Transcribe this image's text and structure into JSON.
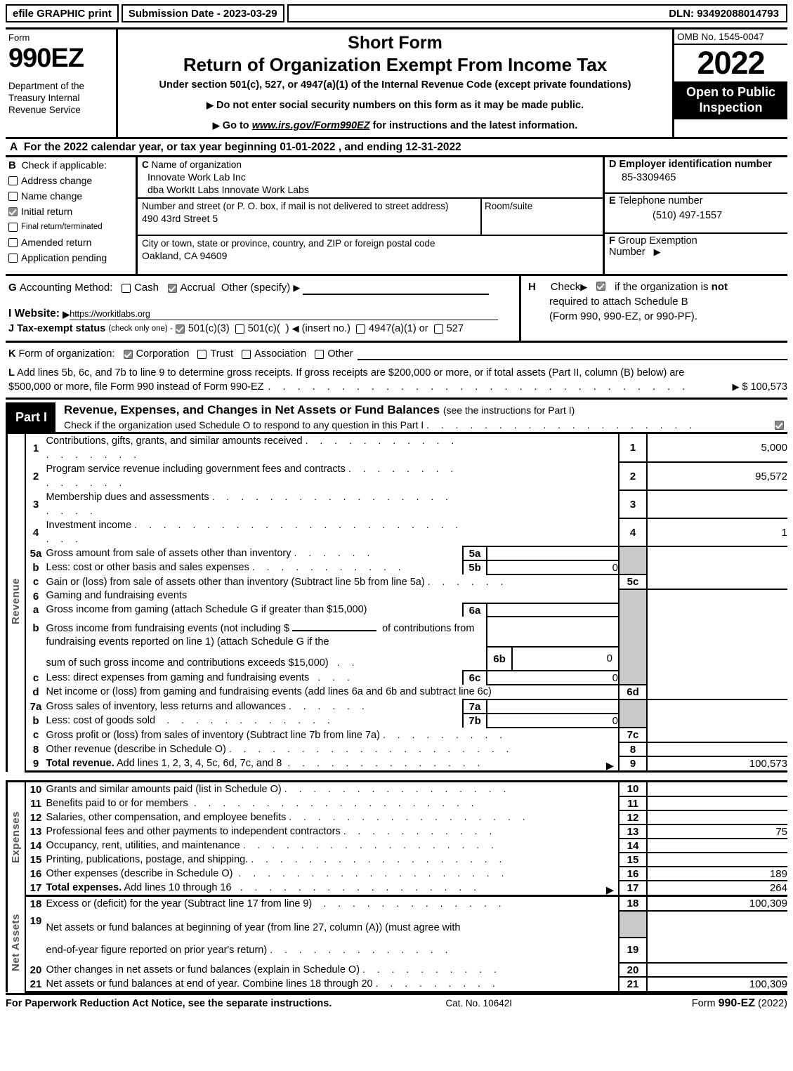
{
  "efile": {
    "graphic_print": "efile GRAPHIC print",
    "submission_date": "Submission Date - 2023-03-29",
    "dln": "DLN: 93492088014793"
  },
  "masthead": {
    "form_label": "Form",
    "form_number": "990EZ",
    "department": "Department of the Treasury Internal Revenue Service",
    "title_line1": "Short Form",
    "title_line2": "Return of Organization Exempt From Income Tax",
    "subtitle": "Under section 501(c), 527, or 4947(a)(1) of the Internal Revenue Code (except private foundations)",
    "note1": "Do not enter social security numbers on this form as it may be made public.",
    "note2_prefix": "Go to ",
    "note2_link": "www.irs.gov/Form990EZ",
    "note2_suffix": " for instructions and the latest information.",
    "omb": "OMB No. 1545-0047",
    "year": "2022",
    "open_to_public": "Open to Public Inspection"
  },
  "lineA": {
    "letter": "A",
    "text": "For the 2022 calendar year, or tax year beginning 01-01-2022 , and ending 12-31-2022"
  },
  "sectionB": {
    "letter": "B",
    "heading": "Check if applicable:",
    "items": [
      {
        "label": "Address change",
        "checked": false,
        "small": false
      },
      {
        "label": "Name change",
        "checked": false,
        "small": false
      },
      {
        "label": "Initial return",
        "checked": true,
        "small": false
      },
      {
        "label": "Final return/terminated",
        "checked": false,
        "small": true
      },
      {
        "label": "Amended return",
        "checked": false,
        "small": false
      },
      {
        "label": "Application pending",
        "checked": false,
        "small": false
      }
    ]
  },
  "sectionC": {
    "letter": "C",
    "name_label": "Name of organization",
    "name_line1": "Innovate Work Lab Inc",
    "name_line2": "dba WorkIt Labs Innovate Work Labs",
    "street_label": "Number and street (or P. O. box, if mail is not delivered to street address)",
    "street_value": "490 43rd Street 5",
    "room_label": "Room/suite",
    "room_value": "",
    "city_label": "City or town, state or province, country, and ZIP or foreign postal code",
    "city_value": "Oakland, CA   94609"
  },
  "sectionD": {
    "letter": "D",
    "label": "Employer identification number",
    "value": "85-3309465"
  },
  "sectionE": {
    "letter": "E",
    "label": "Telephone number",
    "value": "(510) 497-1557"
  },
  "sectionF": {
    "letter": "F",
    "label_line1": "Group Exemption",
    "label_line2": "Number",
    "value": ""
  },
  "sectionG": {
    "letter": "G",
    "label": "Accounting Method:",
    "cash": "Cash",
    "cash_checked": false,
    "accrual": "Accrual",
    "accrual_checked": true,
    "other": "Other (specify)",
    "other_value": ""
  },
  "sectionH": {
    "letter": "H",
    "check_label": "Check",
    "checked": true,
    "text_line1_a": "if the organization is ",
    "text_line1_b": "not",
    "text_line2": "required to attach Schedule B",
    "text_line3": "(Form 990, 990-EZ, or 990-PF)."
  },
  "sectionI": {
    "letter": "I",
    "label": "Website:",
    "value": "https://workitlabs.org"
  },
  "sectionJ": {
    "letter": "J",
    "label": "Tax-exempt status",
    "note": "(check only one) -",
    "opt1": "501(c)(3)",
    "opt1_checked": true,
    "opt2": "501(c)(",
    "opt2_checked": false,
    "opt2_suffix": ")",
    "insert_no": "(insert no.)",
    "opt3": "4947(a)(1) or",
    "opt3_checked": false,
    "opt4": "527",
    "opt4_checked": false
  },
  "sectionK": {
    "letter": "K",
    "label": "Form of organization:",
    "options": [
      {
        "label": "Corporation",
        "checked": true
      },
      {
        "label": "Trust",
        "checked": false
      },
      {
        "label": "Association",
        "checked": false
      },
      {
        "label": "Other",
        "checked": false
      }
    ],
    "other_value": ""
  },
  "sectionL": {
    "letter": "L",
    "line1": "Add lines 5b, 6c, and 7b to line 9 to determine gross receipts. If gross receipts are $200,000 or more, or if total assets (Part II, column (B) below) are",
    "line2": "$500,000 or more, file Form 990 instead of Form 990-EZ",
    "amount_prefix": "$",
    "amount": "100,573"
  },
  "partI": {
    "label": "Part I",
    "title": "Revenue, Expenses, and Changes in Net Assets or Fund Balances",
    "title_note": "(see the instructions for Part I)",
    "schedule_o": "Check if the organization used Schedule O to respond to any question in this Part I",
    "schedule_o_checked": true,
    "sidebar_revenue": "Revenue",
    "sidebar_expenses": "Expenses",
    "sidebar_netassets": "Net Assets",
    "rows": [
      {
        "no": "1",
        "desc": "Contributions, gifts, grants, and similar amounts received",
        "dots": 20,
        "lnum": "1",
        "lval": "5,000"
      },
      {
        "no": "2",
        "desc": "Program service revenue including government fees and contracts",
        "dots": 16,
        "lnum": "2",
        "lval": "95,572"
      },
      {
        "no": "3",
        "desc": "Membership dues and assessments",
        "dots": 25,
        "lnum": "3",
        "lval": ""
      },
      {
        "no": "4",
        "desc": "Investment income",
        "dots": 29,
        "lnum": "4",
        "lval": "1"
      },
      {
        "no": "5a",
        "desc": "Gross amount from sale of assets other than inventory",
        "dots": 7,
        "inner_n": "5a",
        "inner_v": "",
        "lnum": "",
        "lval": ""
      },
      {
        "no": "b",
        "desc": "Less: cost or other basis and sales expenses",
        "dots": 12,
        "inner_n": "5b",
        "inner_v": "0",
        "lnum": "",
        "lval": ""
      },
      {
        "no": "c",
        "desc": "Gain or (loss) from sale of assets other than inventory (Subtract line 5b from line 5a)",
        "dots": 7,
        "lnum": "5c",
        "lval": ""
      },
      {
        "no": "6",
        "desc": "Gaming and fundraising events",
        "dots": 0,
        "lnum": "",
        "lval": ""
      },
      {
        "no": "a",
        "desc": "Gross income from gaming (attach Schedule G if greater than $15,000)",
        "dots": 0,
        "inner_n": "6a",
        "inner_v": "",
        "lnum": "",
        "lval": ""
      },
      {
        "no": "b",
        "desc": "Gross income from fundraising events (not including $ ______ of contributions from fundraising events reported on line 1) (attach Schedule G if the sum of such gross income and contributions exceeds $15,000)",
        "dots": 2,
        "inner_n": "6b",
        "inner_v": "0",
        "lnum": "",
        "lval": ""
      },
      {
        "no": "c",
        "desc": "Less: direct expenses from gaming and fundraising events",
        "dots": 3,
        "inner_n": "6c",
        "inner_v": "0",
        "lnum": "",
        "lval": ""
      },
      {
        "no": "d",
        "desc": "Net income or (loss) from gaming and fundraising events (add lines 6a and 6b and subtract line 6c)",
        "dots": 0,
        "lnum": "6d",
        "lval": ""
      },
      {
        "no": "7a",
        "desc": "Gross sales of inventory, less returns and allowances",
        "dots": 7,
        "inner_n": "7a",
        "inner_v": "",
        "lnum": "",
        "lval": ""
      },
      {
        "no": "b",
        "desc": "Less: cost of goods sold",
        "dots": 14,
        "inner_n": "7b",
        "inner_v": "0",
        "lnum": "",
        "lval": ""
      },
      {
        "no": "c",
        "desc": "Gross profit or (loss) from sales of inventory (Subtract line 7b from line 7a)",
        "dots": 10,
        "lnum": "7c",
        "lval": ""
      },
      {
        "no": "8",
        "desc": "Other revenue (describe in Schedule O)",
        "dots": 22,
        "lnum": "8",
        "lval": ""
      },
      {
        "no": "9",
        "desc": "Total revenue. Add lines 1, 2, 3, 4, 5c, 6d, 7c, and 8",
        "desc_bold": "Total revenue.",
        "dots": 16,
        "arrow": true,
        "lnum": "9",
        "lval": "100,573"
      },
      {
        "no": "10",
        "desc": "Grants and similar amounts paid (list in Schedule O)",
        "dots": 18,
        "lnum": "10",
        "lval": ""
      },
      {
        "no": "11",
        "desc": "Benefits paid to or for members",
        "dots": 24,
        "lnum": "11",
        "lval": ""
      },
      {
        "no": "12",
        "desc": "Salaries, other compensation, and employee benefits",
        "dots": 19,
        "lnum": "12",
        "lval": ""
      },
      {
        "no": "13",
        "desc": "Professional fees and other payments to independent contractors",
        "dots": 13,
        "lnum": "13",
        "lval": "75"
      },
      {
        "no": "14",
        "desc": "Occupancy, rent, utilities, and maintenance",
        "dots": 20,
        "lnum": "14",
        "lval": ""
      },
      {
        "no": "15",
        "desc": "Printing, publications, postage, and shipping.",
        "dots": 19,
        "lnum": "15",
        "lval": ""
      },
      {
        "no": "16",
        "desc": "Other expenses (describe in Schedule O)",
        "dots": 21,
        "lnum": "16",
        "lval": "189"
      },
      {
        "no": "17",
        "desc": "Total expenses. Add lines 10 through 16",
        "desc_bold": "Total expenses.",
        "dots": 19,
        "arrow": true,
        "lnum": "17",
        "lval": "264"
      },
      {
        "no": "18",
        "desc": "Excess or (deficit) for the year (Subtract line 17 from line 9)",
        "dots": 16,
        "lnum": "18",
        "lval": "100,309"
      },
      {
        "no": "19",
        "desc": "Net assets or fund balances at beginning of year (from line 27, column (A)) (must agree with end-of-year figure reported on prior year's return)",
        "dots": 15,
        "lnum": "19",
        "lval": ""
      },
      {
        "no": "20",
        "desc": "Other changes in net assets or fund balances (explain in Schedule O)",
        "dots": 12,
        "lnum": "20",
        "lval": ""
      },
      {
        "no": "21",
        "desc": "Net assets or fund balances at end of year. Combine lines 18 through 20",
        "dots": 11,
        "lnum": "21",
        "lval": "100,309"
      }
    ]
  },
  "footer": {
    "notice": "For Paperwork Reduction Act Notice, see the separate instructions.",
    "cat_no": "Cat. No. 10642I",
    "form_prefix": "Form ",
    "form_name": "990-EZ",
    "form_year": "(2022)"
  }
}
